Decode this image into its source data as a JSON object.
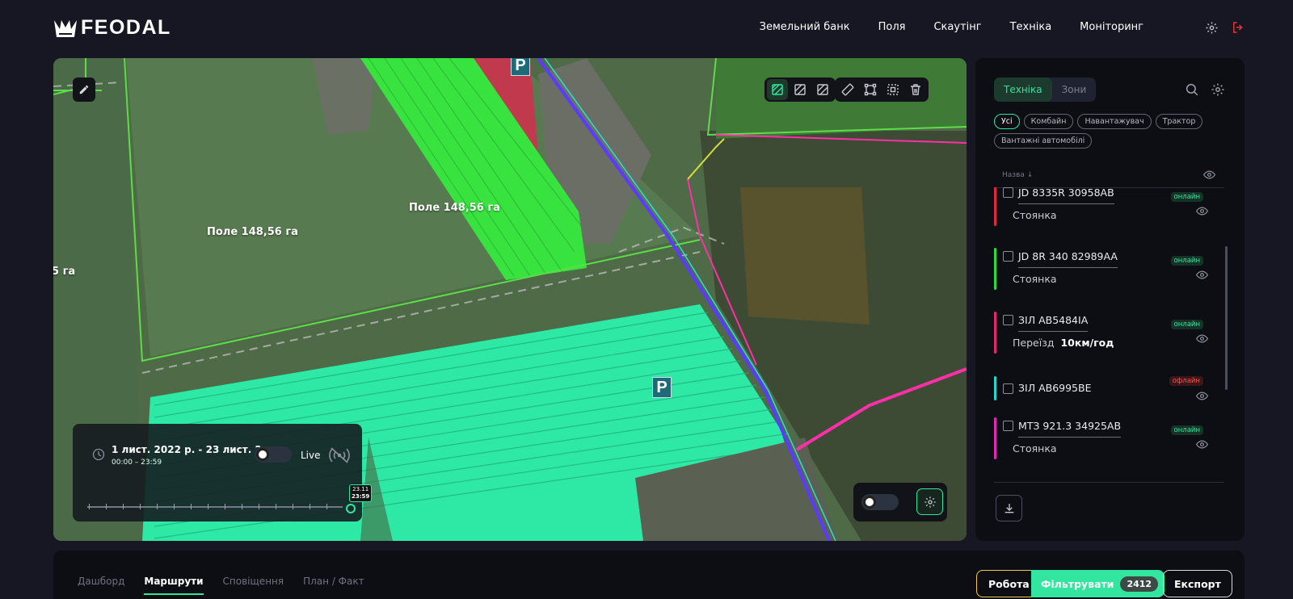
{
  "brand": {
    "name": "FEODAL",
    "logo_icon": "crown-icon"
  },
  "nav": {
    "items": [
      "Земельний банк",
      "Поля",
      "Скаутінг",
      "Техніка",
      "Моніторинг"
    ],
    "settings_icon": "gear-icon",
    "logout_icon": "logout-icon"
  },
  "map": {
    "field_labels": [
      "Поле 148,56 га",
      "Поле 148,56 га",
      "5 га"
    ],
    "parking_label": "P",
    "edit_icon": "pencil-icon",
    "layer_tools": [
      "layer-1-icon",
      "layer-2-icon",
      "layer-3-icon"
    ],
    "draw_tools": [
      "ruler-icon",
      "polygon-icon",
      "select-area-icon",
      "trash-icon"
    ],
    "timeline": {
      "date_range": "1 лист. 2022 р. - 23 лист. 2...",
      "time_range": "00:00 – 23:59",
      "live_label": "Live",
      "live_enabled": false,
      "end_date": "23.11",
      "end_time": "23:59"
    },
    "bottom_toggle_enabled": false
  },
  "panel": {
    "tabs": [
      "Техніка",
      "Зони"
    ],
    "active_tab": 0,
    "filters": [
      "Усі",
      "Комбайн",
      "Навантажувач",
      "Трактор",
      "Вантажні автомобілі"
    ],
    "active_filter": 0,
    "column_header": "Назва ↓",
    "vehicles": [
      {
        "name": "JD 8335R 30958AB",
        "status": "Стоянка",
        "speed": "",
        "online": "онлайн",
        "is_online": true,
        "color": "#e3283f"
      },
      {
        "name": "JD 8R 340 82989AA",
        "status": "Стоянка",
        "speed": "",
        "online": "онлайн",
        "is_online": true,
        "color": "#2edb3a"
      },
      {
        "name": "ЗІЛ AB5484IA",
        "status": "Переїзд",
        "speed": "10км/год",
        "online": "онлайн",
        "is_online": true,
        "color": "#e3286b"
      },
      {
        "name": "ЗІЛ AB6995BE",
        "status": "",
        "speed": "",
        "online": "офлайн",
        "is_online": false,
        "color": "#27d6d0"
      },
      {
        "name": "МТЗ 921.3 34925AB",
        "status": "Стоянка",
        "speed": "",
        "online": "онлайн",
        "is_online": true,
        "color": "#e328b8"
      }
    ],
    "download_icon": "download-icon"
  },
  "bottom": {
    "tabs": [
      "Дашборд",
      "Маршрути",
      "Сповіщення",
      "План / Факт"
    ],
    "active_tab": 1,
    "work_label": "Робота",
    "filter_label": "Фільтрувати",
    "filter_count": "2412",
    "export_label": "Експорт"
  },
  "colors": {
    "accent": "#33e69f",
    "work_border": "#f2c94c",
    "offline": "#ff4d4d"
  }
}
